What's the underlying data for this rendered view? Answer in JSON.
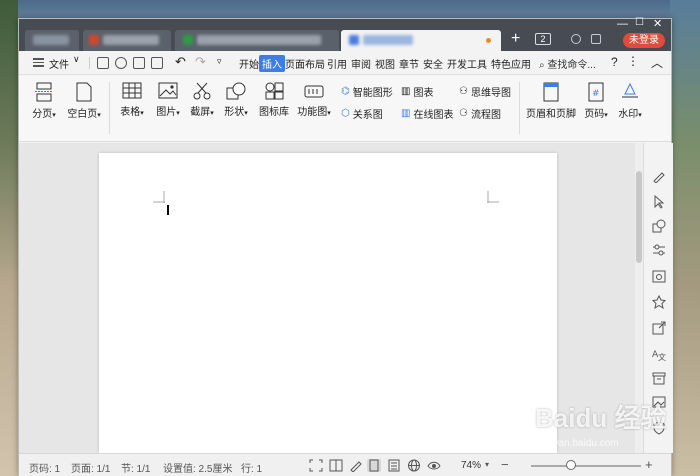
{
  "tabs": [
    {
      "label": ""
    },
    {
      "label": ""
    },
    {
      "label": ""
    },
    {
      "label": ""
    }
  ],
  "tabbar": {
    "tab_count": "2",
    "login_label": "未登录"
  },
  "menu": {
    "file_label": "文件",
    "items": [
      "开始",
      "插入",
      "页面布局",
      "引用",
      "审阅",
      "视图",
      "章节",
      "安全",
      "开发工具",
      "特色应用"
    ],
    "active": "插入",
    "search_label": "查找命令...",
    "help_label": "?"
  },
  "ribbon": {
    "page_break": "分页",
    "blank_page": "空白页",
    "table": "表格",
    "picture": "图片",
    "screenshot": "截屏",
    "shape": "形状",
    "icon_lib": "图标库",
    "function_chart": "功能图",
    "smart_graphic": "智能图形",
    "chart": "图表",
    "mind_map": "思维导图",
    "relation_chart": "关系图",
    "online_chart": "在线图表",
    "flow_chart": "流程图",
    "header_footer": "页眉和页脚",
    "page_number": "页码",
    "watermark": "水印"
  },
  "status": {
    "page_code": "页码: 1",
    "pages": "页面: 1/1",
    "section": "节: 1/1",
    "setting": "设置值: 2.5厘米",
    "line": "行: 1",
    "zoom": "74%",
    "zoom_level": 0.74
  },
  "watermark_text": {
    "brand": "Baidu 经验",
    "sub": "jingyan.baidu.com"
  },
  "colors": {
    "accent": "#3d7de6",
    "login": "#e04c3c",
    "tabbar": "#474b52"
  }
}
